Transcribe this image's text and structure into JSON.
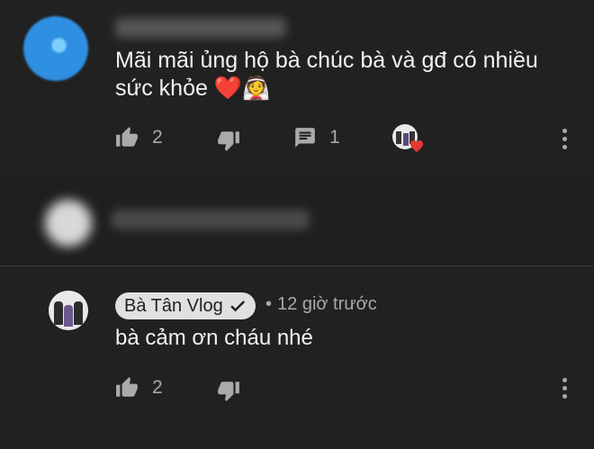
{
  "comment1": {
    "text": "Mãi mãi ủng hộ bà chúc bà và gđ có nhiều sức khỏe ❤️",
    "emoji": "👰",
    "like_count": "2",
    "reply_count": "1",
    "creator_heart": true
  },
  "comment2": {
    "author": "Bà Tân Vlog",
    "separator": "•",
    "time": "12 giờ trước",
    "text": "bà cảm ơn cháu nhé",
    "like_count": "2"
  },
  "colors": {
    "background": "#212121",
    "icon": "#aaaaaa",
    "heart": "#e53935",
    "chip": "#e0e0e0"
  },
  "icons": [
    "like-icon",
    "dislike-icon",
    "reply-icon",
    "more-vertical-icon",
    "verified-check-icon",
    "heart-icon"
  ]
}
